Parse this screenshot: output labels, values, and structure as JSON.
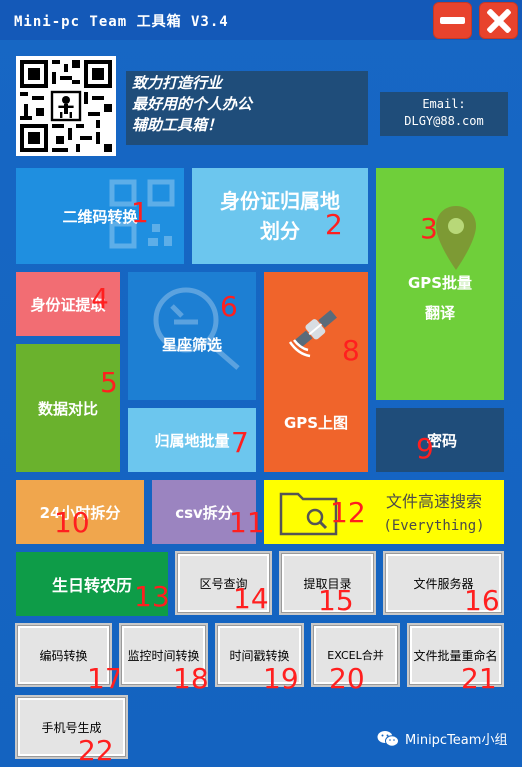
{
  "window": {
    "title": "Mini-pc Team 工具箱 V3.4"
  },
  "header": {
    "slogan": "致力打造行业\n最好用的个人办公\n辅助工具箱！",
    "email_label": "Email:",
    "email": "DLGY@88.com"
  },
  "tiles": {
    "qr_convert": {
      "label": "二维码转换",
      "number": "1",
      "color": "#1f8fe0"
    },
    "id_region": {
      "label": "身份证归属地\n划分",
      "number": "2",
      "color": "#6cc6ee"
    },
    "gps_translate": {
      "label": "GPS批量\n翻译",
      "number": "3",
      "color": "#6fcf3a"
    },
    "id_extract": {
      "label": "身份证提取",
      "number": "4",
      "color": "#f26d73"
    },
    "data_compare": {
      "label": "数据对比",
      "number": "5",
      "color": "#6ab22d"
    },
    "zodiac_filter": {
      "label": "星座筛选",
      "number": "6",
      "color": "#1d7fd3"
    },
    "region_batch": {
      "label": "归属地批量",
      "number": "7",
      "color": "#6cc6ee"
    },
    "gps_map": {
      "label": "GPS上图",
      "number": "8",
      "color": "#f0642b"
    },
    "password": {
      "label": "密码",
      "number": "9",
      "color": "#1f4d7a"
    },
    "split_24h": {
      "label": "24小时拆分",
      "number": "10",
      "color": "#f0a64d"
    },
    "csv_split": {
      "label": "csv拆分",
      "number": "11",
      "color": "#9b84c0"
    },
    "file_search": {
      "label": "文件高速搜索",
      "sub": "(Everything)",
      "number": "12",
      "color": "#ffff00"
    },
    "lunar_birthday": {
      "label": "生日转农历",
      "number": "13",
      "color": "#0e9c48"
    }
  },
  "buttons": {
    "area_code": {
      "label": "区号查询",
      "number": "14"
    },
    "extract_dir": {
      "label": "提取目录",
      "number": "15"
    },
    "file_server": {
      "label": "文件服务器",
      "number": "16"
    },
    "encoding": {
      "label": "编码转换",
      "number": "17"
    },
    "monitor_time": {
      "label": "监控时间转换",
      "number": "18"
    },
    "timestamp": {
      "label": "时间戳转换",
      "number": "19"
    },
    "excel_merge": {
      "label": "EXCEL合并",
      "number": "20"
    },
    "batch_rename": {
      "label": "文件批量重命名",
      "number": "21"
    },
    "phone_gen": {
      "label": "手机号生成",
      "number": "22"
    }
  },
  "footer": {
    "text": "MinipcTeam小组"
  }
}
